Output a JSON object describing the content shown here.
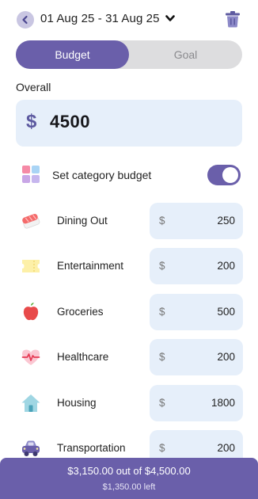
{
  "header": {
    "date_range": "01 Aug 25 - 31 Aug 25"
  },
  "tabs": [
    {
      "label": "Budget",
      "active": true
    },
    {
      "label": "Goal",
      "active": false
    }
  ],
  "overall": {
    "label": "Overall",
    "currency": "$",
    "value": "4500"
  },
  "category_toggle": {
    "label": "Set category budget",
    "on": true
  },
  "categories": [
    {
      "name": "Dining Out",
      "icon": "sushi-icon",
      "currency": "$",
      "amount": "250"
    },
    {
      "name": "Entertainment",
      "icon": "ticket-icon",
      "currency": "$",
      "amount": "200"
    },
    {
      "name": "Groceries",
      "icon": "apple-icon",
      "currency": "$",
      "amount": "500"
    },
    {
      "name": "Healthcare",
      "icon": "heartbeat-icon",
      "currency": "$",
      "amount": "200"
    },
    {
      "name": "Housing",
      "icon": "house-icon",
      "currency": "$",
      "amount": "1800"
    },
    {
      "name": "Transportation",
      "icon": "car-icon",
      "currency": "$",
      "amount": "200"
    }
  ],
  "summary": {
    "spent_text": "$3,150.00 out of $4,500.00",
    "left_text": "$1,350.00 left"
  },
  "colors": {
    "accent": "#6a5faa",
    "field_bg": "#e6effa",
    "segment_bg": "#dddddf"
  }
}
